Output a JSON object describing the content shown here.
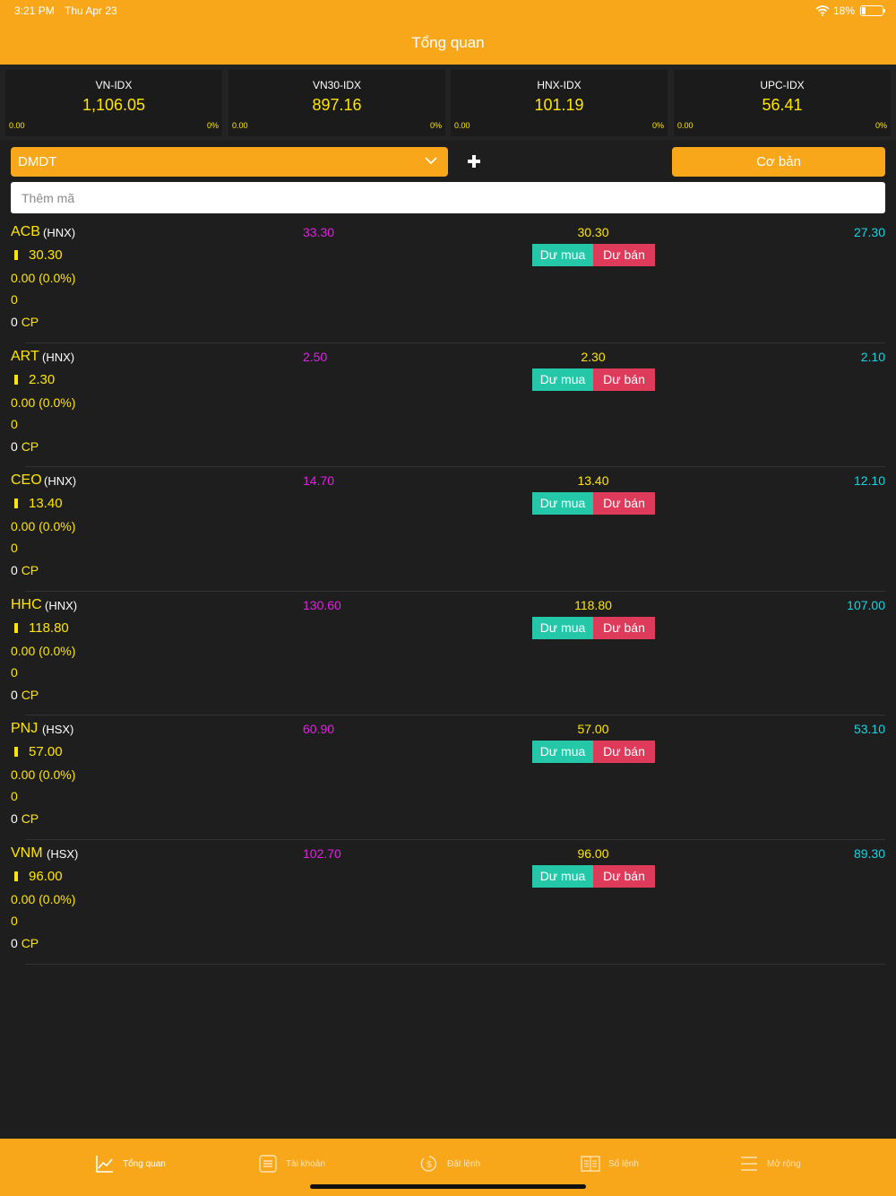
{
  "status": {
    "time": "3:21 PM",
    "date": "Thu Apr 23",
    "battery": "18%"
  },
  "header": {
    "title": "Tổng quan"
  },
  "indices": [
    {
      "name": "VN-IDX",
      "value": "1,106.05",
      "change": "0.00",
      "pct": "0%"
    },
    {
      "name": "VN30-IDX",
      "value": "897.16",
      "change": "0.00",
      "pct": "0%"
    },
    {
      "name": "HNX-IDX",
      "value": "101.19",
      "change": "0.00",
      "pct": "0%"
    },
    {
      "name": "UPC-IDX",
      "value": "56.41",
      "change": "0.00",
      "pct": "0%"
    }
  ],
  "controls": {
    "watchlist": "DMDT",
    "mode_button": "Cơ bản",
    "add_symbol_placeholder": "Thêm mã"
  },
  "stocks": [
    {
      "symbol": "ACB",
      "exchange": "(HNX)",
      "price": "30.30",
      "change": "0.00 (0.0%)",
      "volume": "0",
      "qty": "0",
      "unit": "CP",
      "ceil": "33.30",
      "ref": "30.30",
      "floor": "27.30",
      "buy": "Dư mua",
      "sell": "Dư bán"
    },
    {
      "symbol": "ART",
      "exchange": "(HNX)",
      "price": "2.30",
      "change": "0.00 (0.0%)",
      "volume": "0",
      "qty": "0",
      "unit": "CP",
      "ceil": "2.50",
      "ref": "2.30",
      "floor": "2.10",
      "buy": "Dư mua",
      "sell": "Dư bán"
    },
    {
      "symbol": "CEO",
      "exchange": "(HNX)",
      "price": "13.40",
      "change": "0.00 (0.0%)",
      "volume": "0",
      "qty": "0",
      "unit": "CP",
      "ceil": "14.70",
      "ref": "13.40",
      "floor": "12.10",
      "buy": "Dư mua",
      "sell": "Dư bán"
    },
    {
      "symbol": "HHC",
      "exchange": "(HNX)",
      "price": "118.80",
      "change": "0.00 (0.0%)",
      "volume": "0",
      "qty": "0",
      "unit": "CP",
      "ceil": "130.60",
      "ref": "118.80",
      "floor": "107.00",
      "buy": "Dư mua",
      "sell": "Dư bán"
    },
    {
      "symbol": "PNJ",
      "exchange": "(HSX)",
      "price": "57.00",
      "change": "0.00 (0.0%)",
      "volume": "0",
      "qty": "0",
      "unit": "CP",
      "ceil": "60.90",
      "ref": "57.00",
      "floor": "53.10",
      "buy": "Dư mua",
      "sell": "Dư bán"
    },
    {
      "symbol": "VNM",
      "exchange": "(HSX)",
      "price": "96.00",
      "change": "0.00 (0.0%)",
      "volume": "0",
      "qty": "0",
      "unit": "CP",
      "ceil": "102.70",
      "ref": "96.00",
      "floor": "89.30",
      "buy": "Dư mua",
      "sell": "Dư bán"
    }
  ],
  "tabbar": {
    "items": [
      {
        "label": "Tổng quan",
        "icon": "chart-line-icon",
        "active": true
      },
      {
        "label": "Tài khoản",
        "icon": "list-icon",
        "active": false
      },
      {
        "label": "Đặt lệnh",
        "icon": "dollar-cycle-icon",
        "active": false
      },
      {
        "label": "Sổ lệnh",
        "icon": "book-icon",
        "active": false
      },
      {
        "label": "Mở rộng",
        "icon": "menu-icon",
        "active": false
      }
    ]
  },
  "colors": {
    "accent": "#f8a71b",
    "background": "#1e1e1e",
    "price_yellow": "#ffe600",
    "ceiling_magenta": "#e61ee6",
    "floor_cyan": "#19d4e0",
    "buy_green": "#24c8a8",
    "sell_red": "#de3a5a"
  }
}
